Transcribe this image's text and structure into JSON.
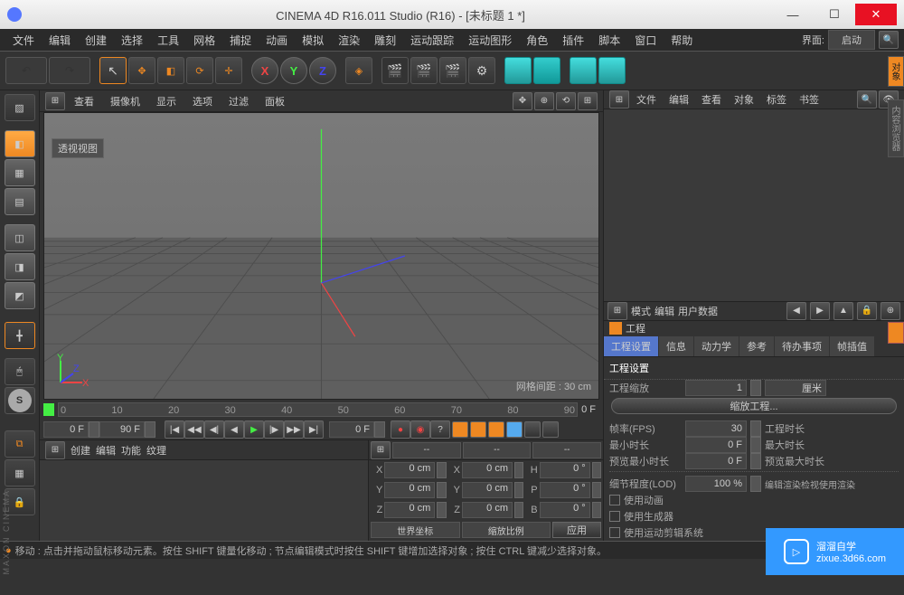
{
  "titlebar": {
    "title": "CINEMA 4D R16.011 Studio (R16) - [未标题 1 *]"
  },
  "menubar": {
    "items": [
      "文件",
      "编辑",
      "创建",
      "选择",
      "工具",
      "网格",
      "捕捉",
      "动画",
      "模拟",
      "渲染",
      "雕刻",
      "运动跟踪",
      "运动图形",
      "角色",
      "插件",
      "脚本",
      "窗口",
      "帮助"
    ],
    "layout_label": "界面:",
    "layout_value": "启动"
  },
  "viewport": {
    "menu": [
      "查看",
      "摄像机",
      "显示",
      "选项",
      "过滤",
      "面板"
    ],
    "label": "透视视图",
    "grid_info": "网格间距 : 30 cm"
  },
  "om": {
    "menu": [
      "文件",
      "编辑",
      "查看",
      "对象",
      "标签",
      "书签"
    ]
  },
  "attr": {
    "menu": [
      "模式",
      "编辑",
      "用户数据"
    ],
    "title": "工程",
    "tabs": [
      "工程设置",
      "信息",
      "动力学",
      "参考",
      "待办事项",
      "帧插值"
    ],
    "section": "工程设置",
    "scale_lbl": "工程缩放",
    "scale_val": "1",
    "scale_unit": "厘米",
    "scale_btn": "缩放工程...",
    "fps_lbl": "帧率(FPS)",
    "fps_val": "30",
    "proj_time_lbl": "工程时长",
    "min_lbl": "最小时长",
    "min_val": "0 F",
    "max_lbl": "最大时长",
    "prev_min_lbl": "预览最小时长",
    "prev_min_val": "0 F",
    "prev_max_lbl": "预览最大时长",
    "lod_lbl": "细节程度(LOD)",
    "lod_val": "100 %",
    "lod_r": "编辑渲染检视使用渲染",
    "cb1": "使用动画",
    "cb2": "使用生成器",
    "cb3": "使用运动剪辑系统"
  },
  "timeline": {
    "ticks": [
      "0",
      "10",
      "20",
      "30",
      "40",
      "50",
      "60",
      "70",
      "80",
      "90"
    ],
    "end_label": "0 F",
    "start": "0 F",
    "end": "90 F",
    "cur": "0 F"
  },
  "materials": {
    "menu": [
      "创建",
      "编辑",
      "功能",
      "纹理"
    ]
  },
  "coords": {
    "x": "0 cm",
    "y": "0 cm",
    "z": "0 cm",
    "sx": "0 cm",
    "sy": "0 cm",
    "sz": "0 cm",
    "h": "0 °",
    "p": "0 °",
    "b": "0 °",
    "dd1": "世界坐标",
    "dd2": "缩放比例",
    "apply": "应用"
  },
  "statusbar": {
    "hint": "移动 : 点击并拖动鼠标移动元素。按住 SHIFT 键量化移动 ; 节点编辑模式时按住 SHIFT 键增加选择对象 ; 按住 CTRL 键减少选择对象。"
  },
  "watermark": {
    "main": "溜溜自学",
    "sub": "zixue.3d66.com"
  },
  "sidelogo": "MAXON CINEMA"
}
